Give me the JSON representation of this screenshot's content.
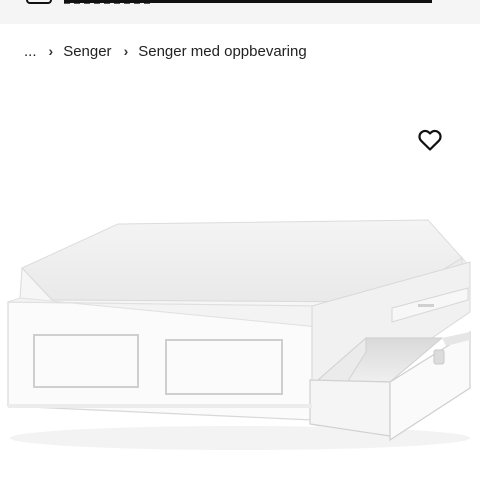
{
  "breadcrumb": {
    "ellipsis": "...",
    "items": [
      {
        "label": "Senger"
      },
      {
        "label": "Senger med oppbevaring"
      }
    ],
    "separator": "›"
  },
  "product": {
    "image_icon": "bed-with-storage-image",
    "favorite_icon": "heart-icon"
  },
  "colors": {
    "top_strip_bg": "#f5f5f5",
    "text": "#111111"
  }
}
